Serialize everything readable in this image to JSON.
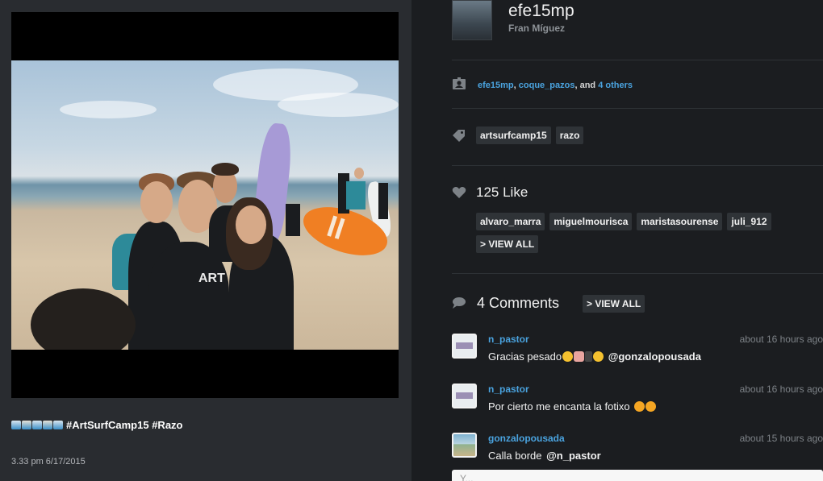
{
  "post": {
    "caption_hashtags": "#ArtSurfCamp15 #Razo",
    "timestamp": "3.33 pm 6/17/2015"
  },
  "profile": {
    "username": "efe15mp",
    "full_name": "Fran Míguez"
  },
  "tagged": {
    "users": [
      "efe15mp",
      "coque_pazos"
    ],
    "separator": ",",
    "conjunction": "and",
    "others_label": "4 others"
  },
  "tags": [
    "artsurfcamp15",
    "razo"
  ],
  "likes": {
    "title": "125 Like",
    "users": [
      "alvaro_marra",
      "miguelmourisca",
      "maristasourense",
      "juli_912"
    ],
    "view_all_label": "> VIEW ALL"
  },
  "comments": {
    "title": "4 Comments",
    "view_all_label": "> VIEW ALL",
    "items": [
      {
        "user": "n_pastor",
        "time": "about 16 hours ago",
        "text": "Gracias pesado",
        "mention": "@gonzalopousada"
      },
      {
        "user": "n_pastor",
        "time": "about 16 hours ago",
        "text": "Por cierto me encanta la fotixo",
        "mention": ""
      },
      {
        "user": "gonzalopousada",
        "time": "about 15 hours ago",
        "text": "Calla borde",
        "mention": "@n_pastor"
      }
    ],
    "input_placeholder": "Y..."
  },
  "colors": {
    "link_blue": "#4aa3df",
    "left_panel_bg": "#292c30",
    "right_panel_bg": "#1b1d20",
    "pill_bg": "#2f3337"
  },
  "icons": {
    "tagged": "person-tag-icon",
    "tags": "tag-icon",
    "likes": "heart-icon",
    "comments": "speech-bubble-icon"
  }
}
